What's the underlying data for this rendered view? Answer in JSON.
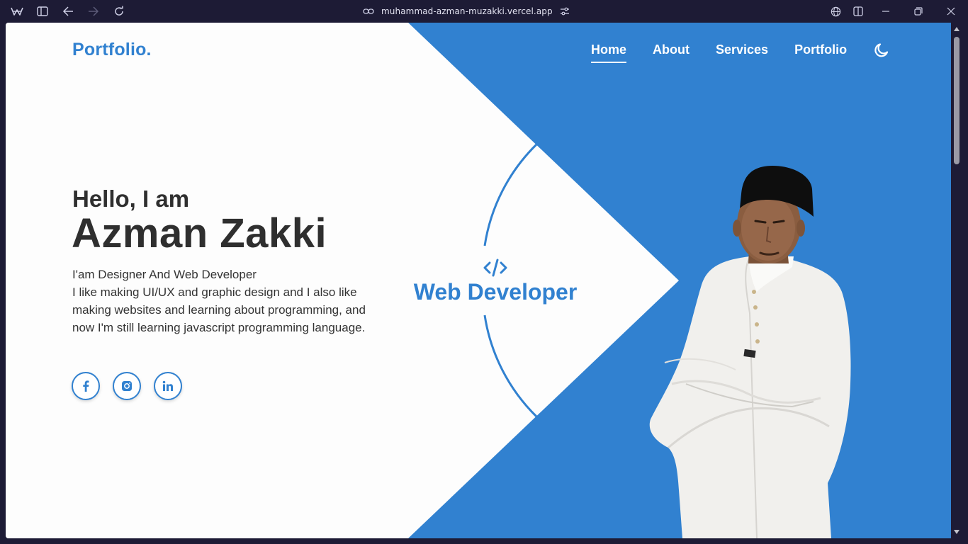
{
  "browser": {
    "url": "muhammad-azman-muzakki.vercel.app"
  },
  "site": {
    "logo": "Portfolio.",
    "nav": [
      {
        "label": "Home",
        "active": true
      },
      {
        "label": "About"
      },
      {
        "label": "Services"
      },
      {
        "label": "Portfolio"
      }
    ],
    "theme_toggle_icon": "moon-icon"
  },
  "hero": {
    "greeting": "Hello, I am",
    "name": "Azman Zakki",
    "desc_line1": "I'am Designer And Web Developer",
    "desc_line2": "I like making UI/UX and graphic design and I also like making websites and learning about programming, and now I'm still learning javascript programming language.",
    "socials": [
      {
        "icon": "facebook-icon"
      },
      {
        "icon": "instagram-icon"
      },
      {
        "icon": "linkedin-icon"
      }
    ],
    "role_icon": "code-icon",
    "role": "Web Developer"
  },
  "colors": {
    "accent": "#3181d0",
    "text_dark": "#2f2f2f",
    "chrome_bg": "#1d1b35"
  }
}
